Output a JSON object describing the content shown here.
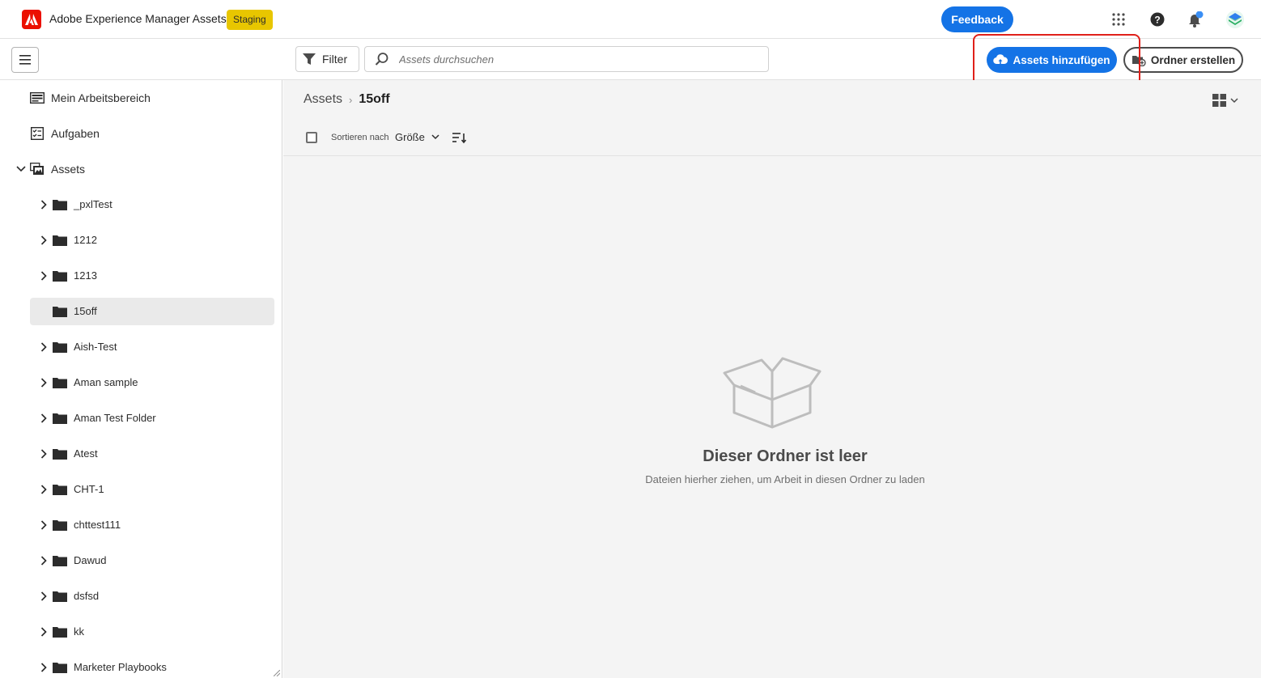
{
  "header": {
    "app_title": "Adobe Experience Manager Assets",
    "env_badge": "Staging",
    "feedback_label": "Feedback",
    "icons": [
      "apps-grid-icon",
      "help-icon",
      "notification-bell-icon",
      "user-avatar"
    ]
  },
  "toolbar": {
    "filter_label": "Filter",
    "search_placeholder": "Assets durchsuchen",
    "add_assets_label": "Assets hinzufügen",
    "create_folder_label": "Ordner erstellen"
  },
  "sidebar": {
    "nav": [
      {
        "label": "Mein Arbeitsbereich",
        "icon": "workspace-icon"
      },
      {
        "label": "Aufgaben",
        "icon": "tasks-icon"
      },
      {
        "label": "Assets",
        "icon": "assets-icon"
      }
    ],
    "folders": [
      {
        "label": "_pxlTest",
        "expandable": true
      },
      {
        "label": "1212",
        "expandable": true
      },
      {
        "label": "1213",
        "expandable": true
      },
      {
        "label": "15off",
        "expandable": false,
        "selected": true
      },
      {
        "label": "Aish-Test",
        "expandable": true
      },
      {
        "label": "Aman sample",
        "expandable": true
      },
      {
        "label": "Aman Test Folder",
        "expandable": true
      },
      {
        "label": "Atest",
        "expandable": true
      },
      {
        "label": "CHT-1",
        "expandable": true
      },
      {
        "label": "chttest111",
        "expandable": true
      },
      {
        "label": "Dawud",
        "expandable": true
      },
      {
        "label": "dsfsd",
        "expandable": true
      },
      {
        "label": "kk",
        "expandable": true
      },
      {
        "label": "Marketer Playbooks",
        "expandable": true
      }
    ]
  },
  "main": {
    "breadcrumb": {
      "root": "Assets",
      "current": "15off"
    },
    "sort_label": "Sortieren nach",
    "sort_value": "Größe",
    "empty_title": "Dieser Ordner ist leer",
    "empty_subtitle": "Dateien hierher ziehen, um Arbeit in diesen Ordner zu laden"
  },
  "colors": {
    "accent": "#1473e6",
    "badge": "#e8c600",
    "highlight": "#e0201a",
    "adobe_red": "#eb1000"
  }
}
